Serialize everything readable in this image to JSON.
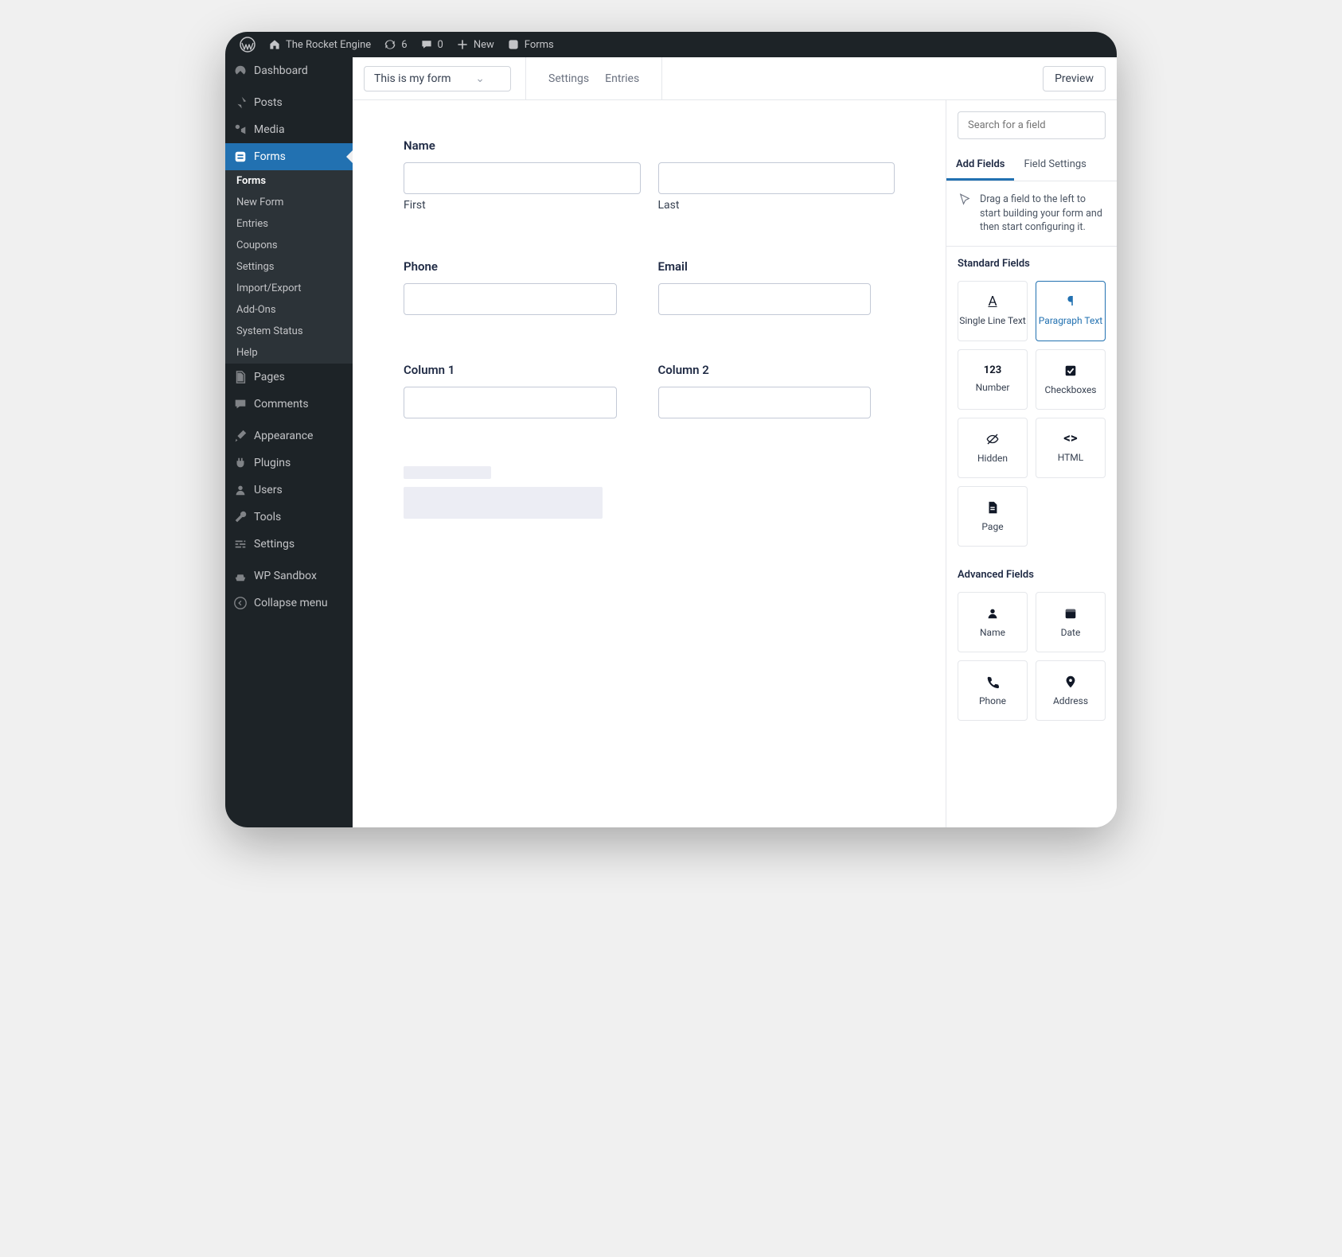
{
  "adminbar": {
    "site_name": "The Rocket Engine",
    "updates_count": "6",
    "comments_count": "0",
    "new_label": "New",
    "context_label": "Forms"
  },
  "sidebar": {
    "dashboard": "Dashboard",
    "posts": "Posts",
    "media": "Media",
    "forms": "Forms",
    "forms_sub": {
      "forms": "Forms",
      "new_form": "New Form",
      "entries": "Entries",
      "coupons": "Coupons",
      "settings": "Settings",
      "import_export": "Import/Export",
      "addons": "Add-Ons",
      "system_status": "System Status",
      "help": "Help"
    },
    "pages": "Pages",
    "comments": "Comments",
    "appearance": "Appearance",
    "plugins": "Plugins",
    "users": "Users",
    "tools": "Tools",
    "settings": "Settings",
    "wp_sandbox": "WP Sandbox",
    "collapse": "Collapse menu"
  },
  "toolbar": {
    "form_name": "This is my form",
    "settings": "Settings",
    "entries": "Entries",
    "preview": "Preview"
  },
  "canvas": {
    "name_label": "Name",
    "first_label": "First",
    "last_label": "Last",
    "phone_label": "Phone",
    "email_label": "Email",
    "col1_label": "Column 1",
    "col2_label": "Column 2"
  },
  "panel": {
    "search_placeholder": "Search for a field",
    "tab_add": "Add Fields",
    "tab_settings": "Field Settings",
    "hint": "Drag a field to the left to start building your form and then start configuring it.",
    "standard_title": "Standard Fields",
    "standard": {
      "single_line": "Single Line Text",
      "paragraph": "Paragraph Text",
      "number": "Number",
      "checkboxes": "Checkboxes",
      "hidden": "Hidden",
      "html": "HTML",
      "page": "Page"
    },
    "advanced_title": "Advanced Fields",
    "advanced": {
      "name": "Name",
      "date": "Date",
      "phone": "Phone",
      "address": "Address"
    }
  }
}
